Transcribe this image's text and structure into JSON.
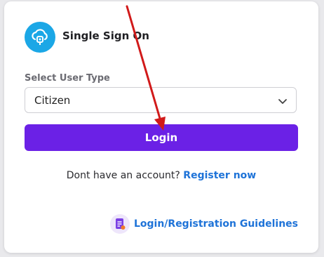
{
  "brand": {
    "title": "Single Sign On"
  },
  "form": {
    "user_type_label": "Select User Type",
    "user_type_value": "Citizen",
    "login_label": "Login"
  },
  "register": {
    "prompt": "Dont have an account?",
    "link": "Register now"
  },
  "guidelines": {
    "label": "Login/Registration Guidelines"
  },
  "colors": {
    "accent": "#6b21e6",
    "link": "#1e73d8",
    "logo": "#1ba7e6",
    "arrow": "#d11a1a"
  },
  "icons": [
    "cloud-lock-icon",
    "chevron-down-icon",
    "document-icon"
  ]
}
